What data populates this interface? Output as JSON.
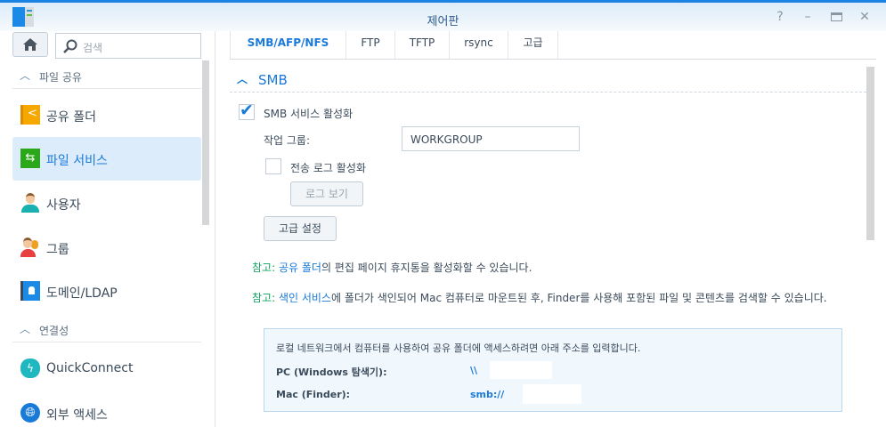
{
  "window": {
    "title": "제어판",
    "help_icon": "help-icon",
    "minimize_icon": "minimize-icon",
    "maximize_icon": "maximize-icon",
    "close_icon": "close-icon"
  },
  "sidebar": {
    "search_placeholder": "검색",
    "sections": [
      {
        "label": "파일 공유",
        "items": [
          {
            "label": "공유 폴더",
            "icon": "shared-folder-icon"
          },
          {
            "label": "파일 서비스",
            "icon": "file-services-icon",
            "selected": true
          },
          {
            "label": "사용자",
            "icon": "user-icon"
          },
          {
            "label": "그룹",
            "icon": "group-icon"
          },
          {
            "label": "도메인/LDAP",
            "icon": "domain-ldap-icon"
          }
        ]
      },
      {
        "label": "연결성",
        "items": [
          {
            "label": "QuickConnect",
            "icon": "quickconnect-icon"
          },
          {
            "label": "외부 액세스",
            "icon": "globe-icon"
          }
        ]
      }
    ]
  },
  "tabs": [
    "SMB/AFP/NFS",
    "FTP",
    "TFTP",
    "rsync",
    "고급"
  ],
  "smb": {
    "section_title": "SMB",
    "enable_label": "SMB 서비스 활성화",
    "enable_checked": true,
    "workgroup_label": "작업 그룹:",
    "workgroup_value": "WORKGROUP",
    "transfer_log_label": "전송 로그 활성화",
    "transfer_log_checked": false,
    "view_log_button": "로그 보기",
    "advanced_button": "고급 설정",
    "note1": {
      "prefix": "참고:",
      "link": "공유 폴더",
      "text": "의 편집 페이지 휴지통을 활성화할 수 있습니다."
    },
    "note2": {
      "prefix": "참고:",
      "link": "색인 서비스",
      "text": "에 폴더가 색인되어 Mac 컴퓨터로 마운트된 후, Finder를 사용해 포함된 파일 및 콘텐츠를 검색할 수 있습니다."
    },
    "info": {
      "intro": "로컬 네트워크에서 컴퓨터를 사용하여 공유 폴더에 액세스하려면 아래 주소를 입력합니다.",
      "pc_label": "PC (Windows 탐색기):",
      "pc_value": "\\\\",
      "mac_label": "Mac (Finder):",
      "mac_value": "smb://"
    }
  },
  "colors": {
    "accent": "#1a7ad8",
    "note_prefix": "#10a060",
    "selected_bg": "#dcecfb"
  }
}
